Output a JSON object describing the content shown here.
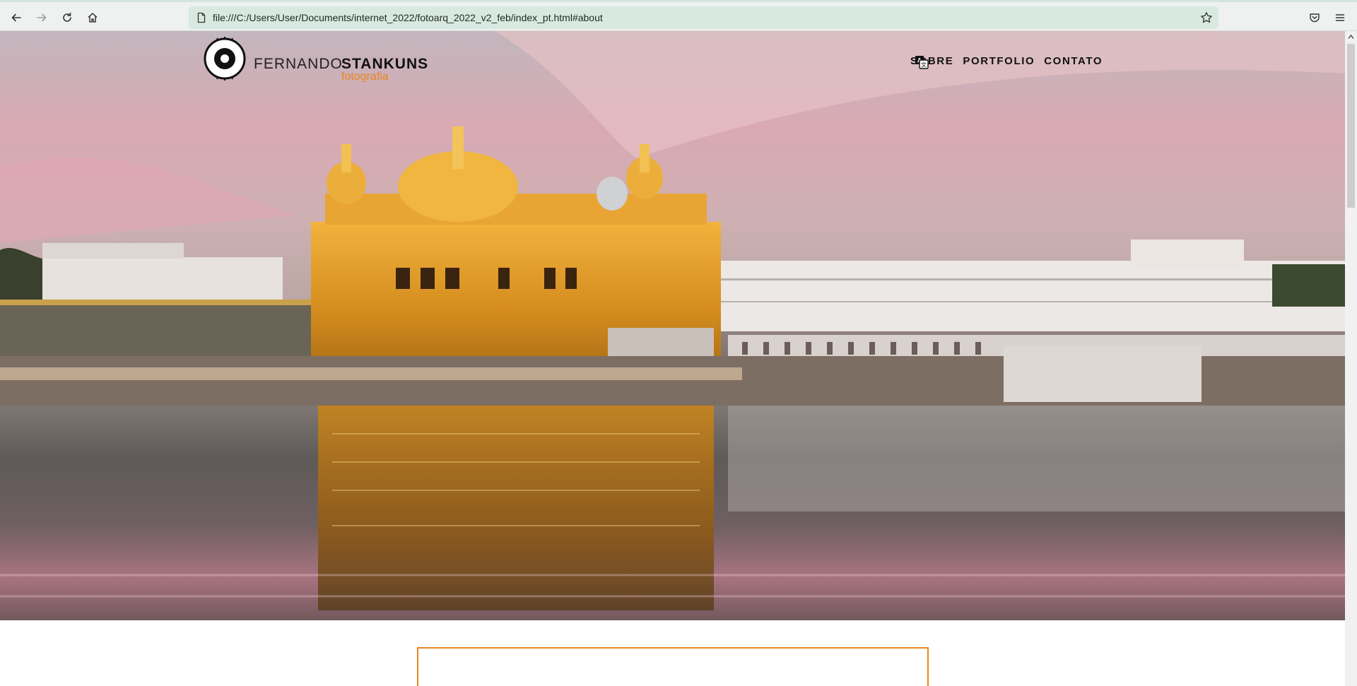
{
  "browser": {
    "url": "file:///C:/Users/User/Documents/internet_2022/fotoarq_2022_v2_feb/index_pt.html#about",
    "icons": [
      "back-icon",
      "forward-icon",
      "reload-icon",
      "home-icon",
      "page-icon",
      "bookmark-star-icon",
      "pocket-icon",
      "menu-icon"
    ]
  },
  "site": {
    "logo": {
      "first_name": "FERNANDO",
      "last_name": "STANKUNS",
      "subtitle": "fotografia"
    },
    "nav": {
      "items": [
        "SOBRE",
        "PORTFOLIO",
        "CONTATO"
      ],
      "translate_icon": "translate-icon"
    },
    "accent_color": "#e8861e"
  }
}
